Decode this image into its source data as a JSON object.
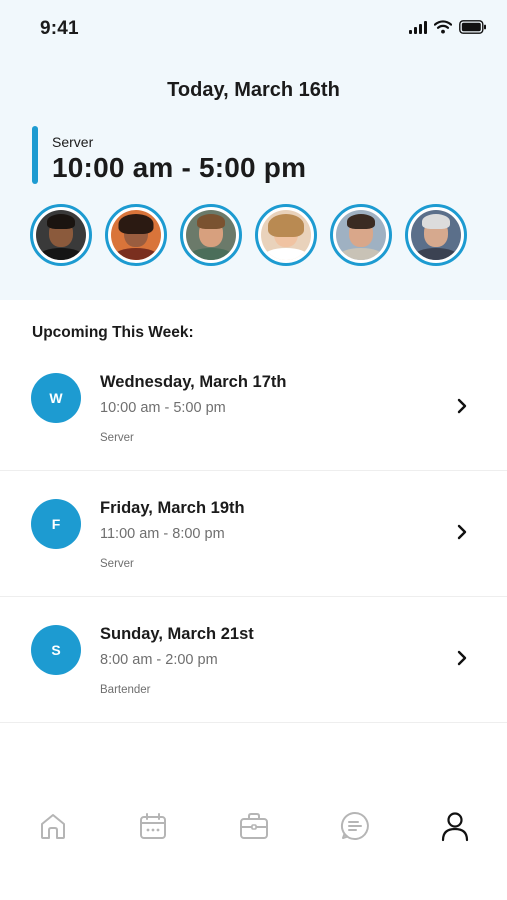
{
  "status_bar": {
    "time": "9:41",
    "icons": [
      "cellular-signal-icon",
      "wifi-icon",
      "battery-icon"
    ]
  },
  "header": {
    "title": "Today, March 16th"
  },
  "current_shift": {
    "role": "Server",
    "hours": "10:00 am - 5:00 pm",
    "accent_color": "#1d9bd1"
  },
  "coworkers": [
    {
      "name": "coworker-1"
    },
    {
      "name": "coworker-2"
    },
    {
      "name": "coworker-3"
    },
    {
      "name": "coworker-4"
    },
    {
      "name": "coworker-5"
    },
    {
      "name": "coworker-6"
    }
  ],
  "upcoming": {
    "title": "Upcoming This Week:",
    "shifts": [
      {
        "badge": "W",
        "date": "Wednesday, March 17th",
        "hours": "10:00 am - 5:00 pm",
        "role": "Server"
      },
      {
        "badge": "F",
        "date": "Friday, March 19th",
        "hours": "11:00 am - 8:00 pm",
        "role": "Server"
      },
      {
        "badge": "S",
        "date": "Sunday, March 21st",
        "hours": "8:00 am - 2:00 pm",
        "role": "Bartender"
      }
    ]
  },
  "tab_bar": {
    "tabs": [
      {
        "icon": "home-icon",
        "active": false
      },
      {
        "icon": "calendar-icon",
        "active": false
      },
      {
        "icon": "briefcase-icon",
        "active": false
      },
      {
        "icon": "messages-icon",
        "active": false
      },
      {
        "icon": "profile-icon",
        "active": true
      }
    ],
    "inactive_color": "#b5b5b5",
    "active_color": "#111111"
  }
}
